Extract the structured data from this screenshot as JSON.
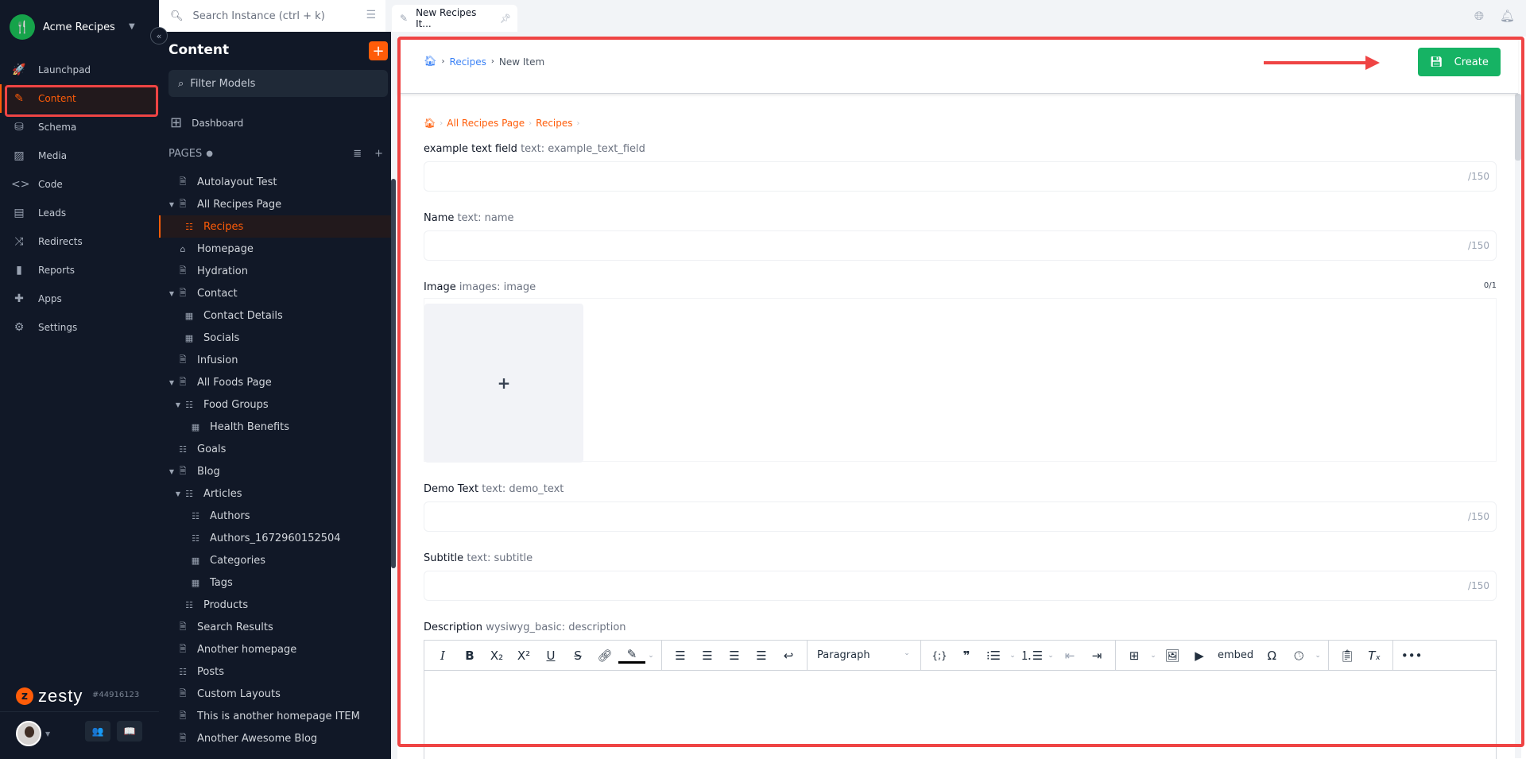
{
  "instance": {
    "name": "Acme Recipes",
    "id": "#44916123",
    "brand": "zesty"
  },
  "global_nav": [
    {
      "label": "Launchpad",
      "icon": "rocket-icon",
      "glyph": "🚀"
    },
    {
      "label": "Content",
      "icon": "pencil-icon",
      "glyph": "✎",
      "active": true
    },
    {
      "label": "Schema",
      "icon": "database-icon",
      "glyph": "⛁"
    },
    {
      "label": "Media",
      "icon": "image-icon",
      "glyph": "▨"
    },
    {
      "label": "Code",
      "icon": "code-icon",
      "glyph": "<>"
    },
    {
      "label": "Leads",
      "icon": "contact-card-icon",
      "glyph": "▤"
    },
    {
      "label": "Redirects",
      "icon": "shuffle-icon",
      "glyph": "⤨"
    },
    {
      "label": "Reports",
      "icon": "bar-chart-icon",
      "glyph": "▮"
    },
    {
      "label": "Apps",
      "icon": "puzzle-icon",
      "glyph": "✚"
    },
    {
      "label": "Settings",
      "icon": "gear-icon",
      "glyph": "⚙"
    }
  ],
  "content_panel": {
    "title": "Content",
    "filter_placeholder": "Filter Models",
    "dashboard_label": "Dashboard",
    "pages_label": "PAGES",
    "tree": [
      {
        "label": "Autolayout Test",
        "icon": "page",
        "depth": 0
      },
      {
        "label": "All Recipes Page",
        "icon": "page",
        "depth": 0,
        "expanded": true
      },
      {
        "label": "Recipes",
        "icon": "list",
        "depth": 1,
        "selected": true
      },
      {
        "label": "Homepage",
        "icon": "home",
        "depth": 0
      },
      {
        "label": "Hydration",
        "icon": "page",
        "depth": 0
      },
      {
        "label": "Contact",
        "icon": "page",
        "depth": 0,
        "expanded": true
      },
      {
        "label": "Contact Details",
        "icon": "dataset",
        "depth": 1
      },
      {
        "label": "Socials",
        "icon": "dataset",
        "depth": 1
      },
      {
        "label": "Infusion",
        "icon": "page",
        "depth": 0
      },
      {
        "label": "All Foods Page",
        "icon": "page",
        "depth": 0,
        "expanded": true
      },
      {
        "label": "Food Groups",
        "icon": "list",
        "depth": 1,
        "expanded": true
      },
      {
        "label": "Health Benefits",
        "icon": "dataset",
        "depth": 2
      },
      {
        "label": "Goals",
        "icon": "list",
        "depth": 0
      },
      {
        "label": "Blog",
        "icon": "page",
        "depth": 0,
        "expanded": true
      },
      {
        "label": "Articles",
        "icon": "list",
        "depth": 1,
        "expanded": true
      },
      {
        "label": "Authors",
        "icon": "list",
        "depth": 2
      },
      {
        "label": "Authors_1672960152504",
        "icon": "list",
        "depth": 2
      },
      {
        "label": "Categories",
        "icon": "dataset",
        "depth": 2
      },
      {
        "label": "Tags",
        "icon": "dataset",
        "depth": 2
      },
      {
        "label": "Products",
        "icon": "list",
        "depth": 1
      },
      {
        "label": "Search Results",
        "icon": "page",
        "depth": 0
      },
      {
        "label": "Another homepage",
        "icon": "page",
        "depth": 0
      },
      {
        "label": "Posts",
        "icon": "list",
        "depth": 0
      },
      {
        "label": "Custom Layouts",
        "icon": "page",
        "depth": 0
      },
      {
        "label": "This is another homepage ITEM",
        "icon": "page",
        "depth": 0
      },
      {
        "label": "Another Awesome Blog",
        "icon": "page",
        "depth": 0
      }
    ]
  },
  "topbar": {
    "search_placeholder": "Search Instance (ctrl + k)",
    "tab_label": "New Recipes It..."
  },
  "header": {
    "breadcrumb": [
      "Recipes",
      "New Item"
    ],
    "create_label": "Create"
  },
  "form": {
    "item_breadcrumb": [
      "All Recipes Page",
      "Recipes"
    ],
    "fields": [
      {
        "label": "example text field",
        "meta": "text: example_text_field",
        "value": "",
        "counter": "/150"
      },
      {
        "label": "Name",
        "meta": "text: name",
        "value": "",
        "counter": "/150"
      },
      {
        "label": "Image",
        "meta": "images: image",
        "count": "0/1"
      },
      {
        "label": "Demo Text",
        "meta": "text: demo_text",
        "value": "",
        "counter": "/150"
      },
      {
        "label": "Subtitle",
        "meta": "text: subtitle",
        "value": "",
        "counter": "/150"
      },
      {
        "label": "Description",
        "meta": "wysiwyg_basic: description"
      }
    ],
    "editor": {
      "block_format": "Paragraph",
      "embed_label": "embed"
    }
  },
  "colors": {
    "accent": "#ff5c08",
    "create": "#16b364",
    "nav_bg": "#111827",
    "annotation": "#ef4444"
  }
}
